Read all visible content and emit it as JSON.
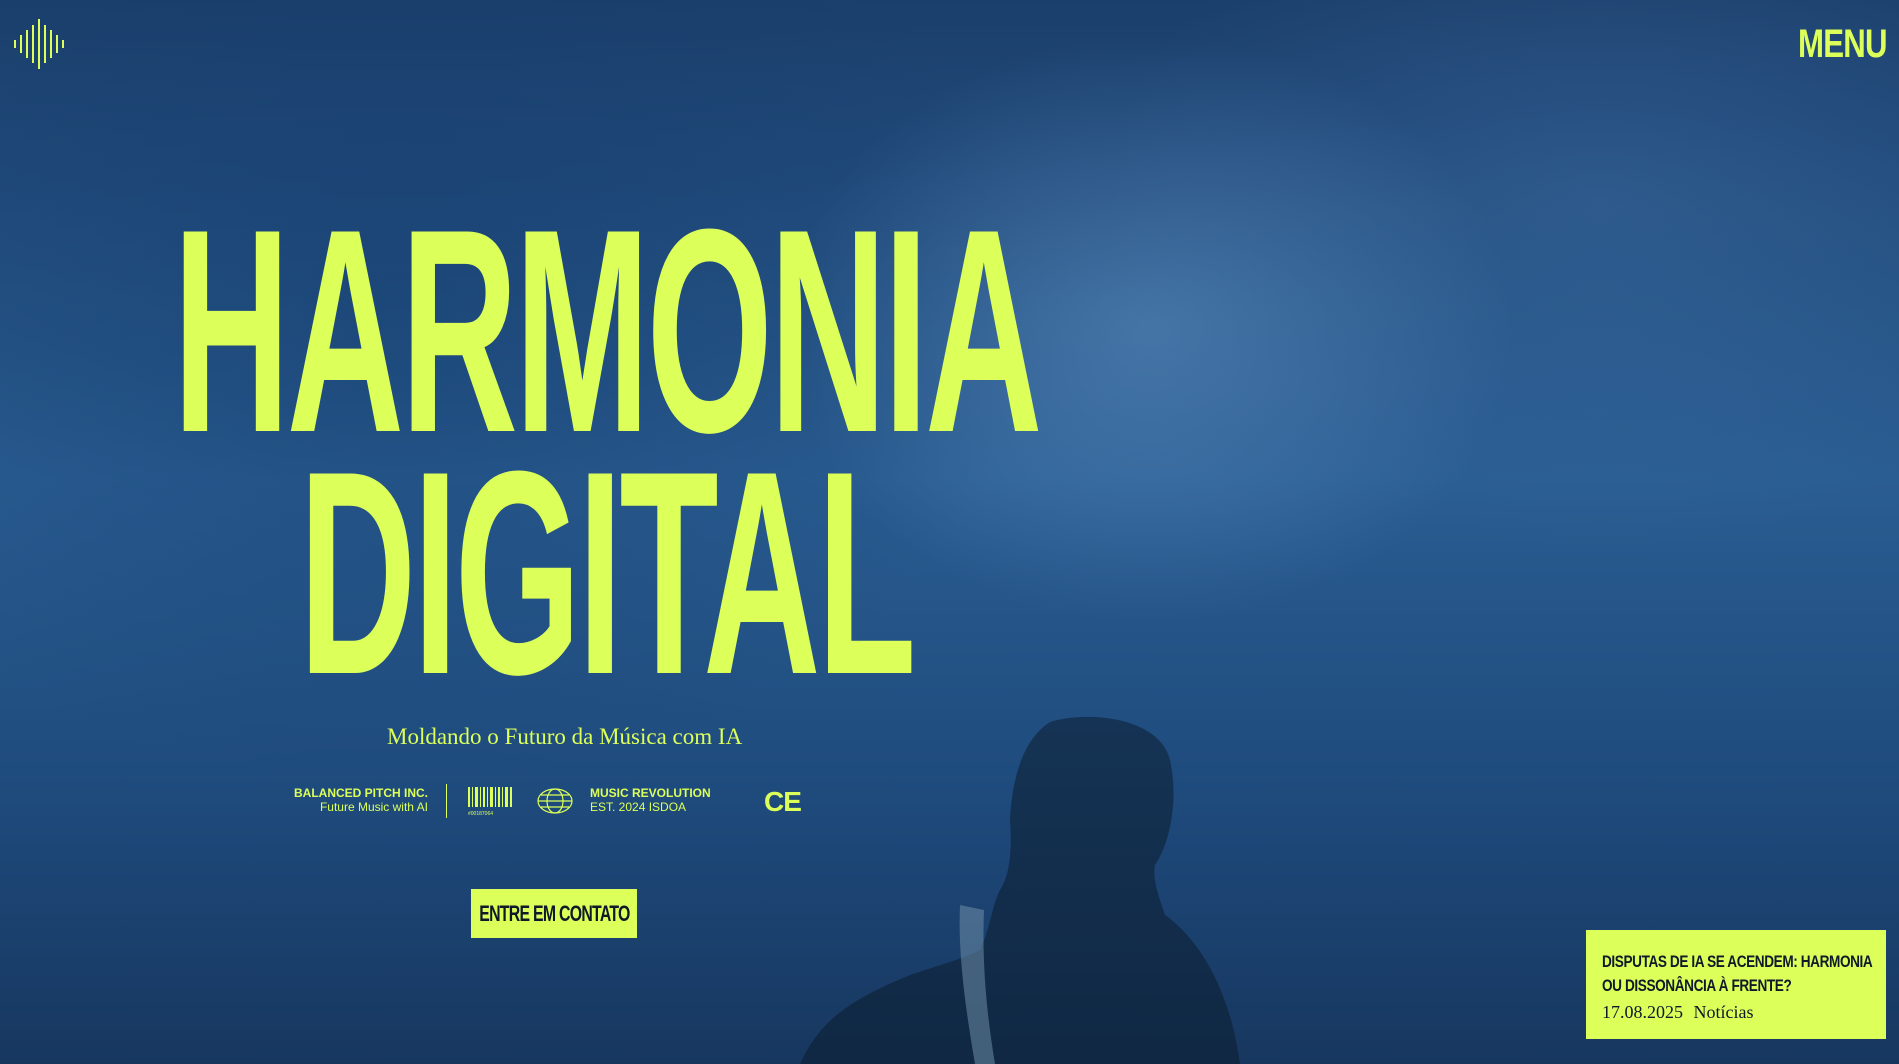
{
  "header": {
    "logo_icon": "sound-wave-logo-icon",
    "menu_label": "MENU"
  },
  "hero": {
    "title_line1": "HARMONIA",
    "title_line2": "DIGITAL",
    "subtitle": "Moldando o Futuro da Música com IA",
    "cta_label": "ENTRE EM CONTATO"
  },
  "badges": {
    "company_name": "BALANCED PITCH INC.",
    "company_tagline": "Future Music with AI",
    "barcode_number": "#00187064",
    "revolution_title": "MUSIC REVOLUTION",
    "revolution_sub": "EST. 2024 ISDOA",
    "ce_mark": "CE"
  },
  "news": {
    "title": "DISPUTAS DE IA SE ACENDEM: HARMONIA OU DISSONÂNCIA À FRENTE?",
    "date": "17.08.2025",
    "category": "Notícias"
  },
  "colors": {
    "accent": "#dcff5a",
    "background": "#1d4a78",
    "dark_text": "#0e1a28"
  }
}
